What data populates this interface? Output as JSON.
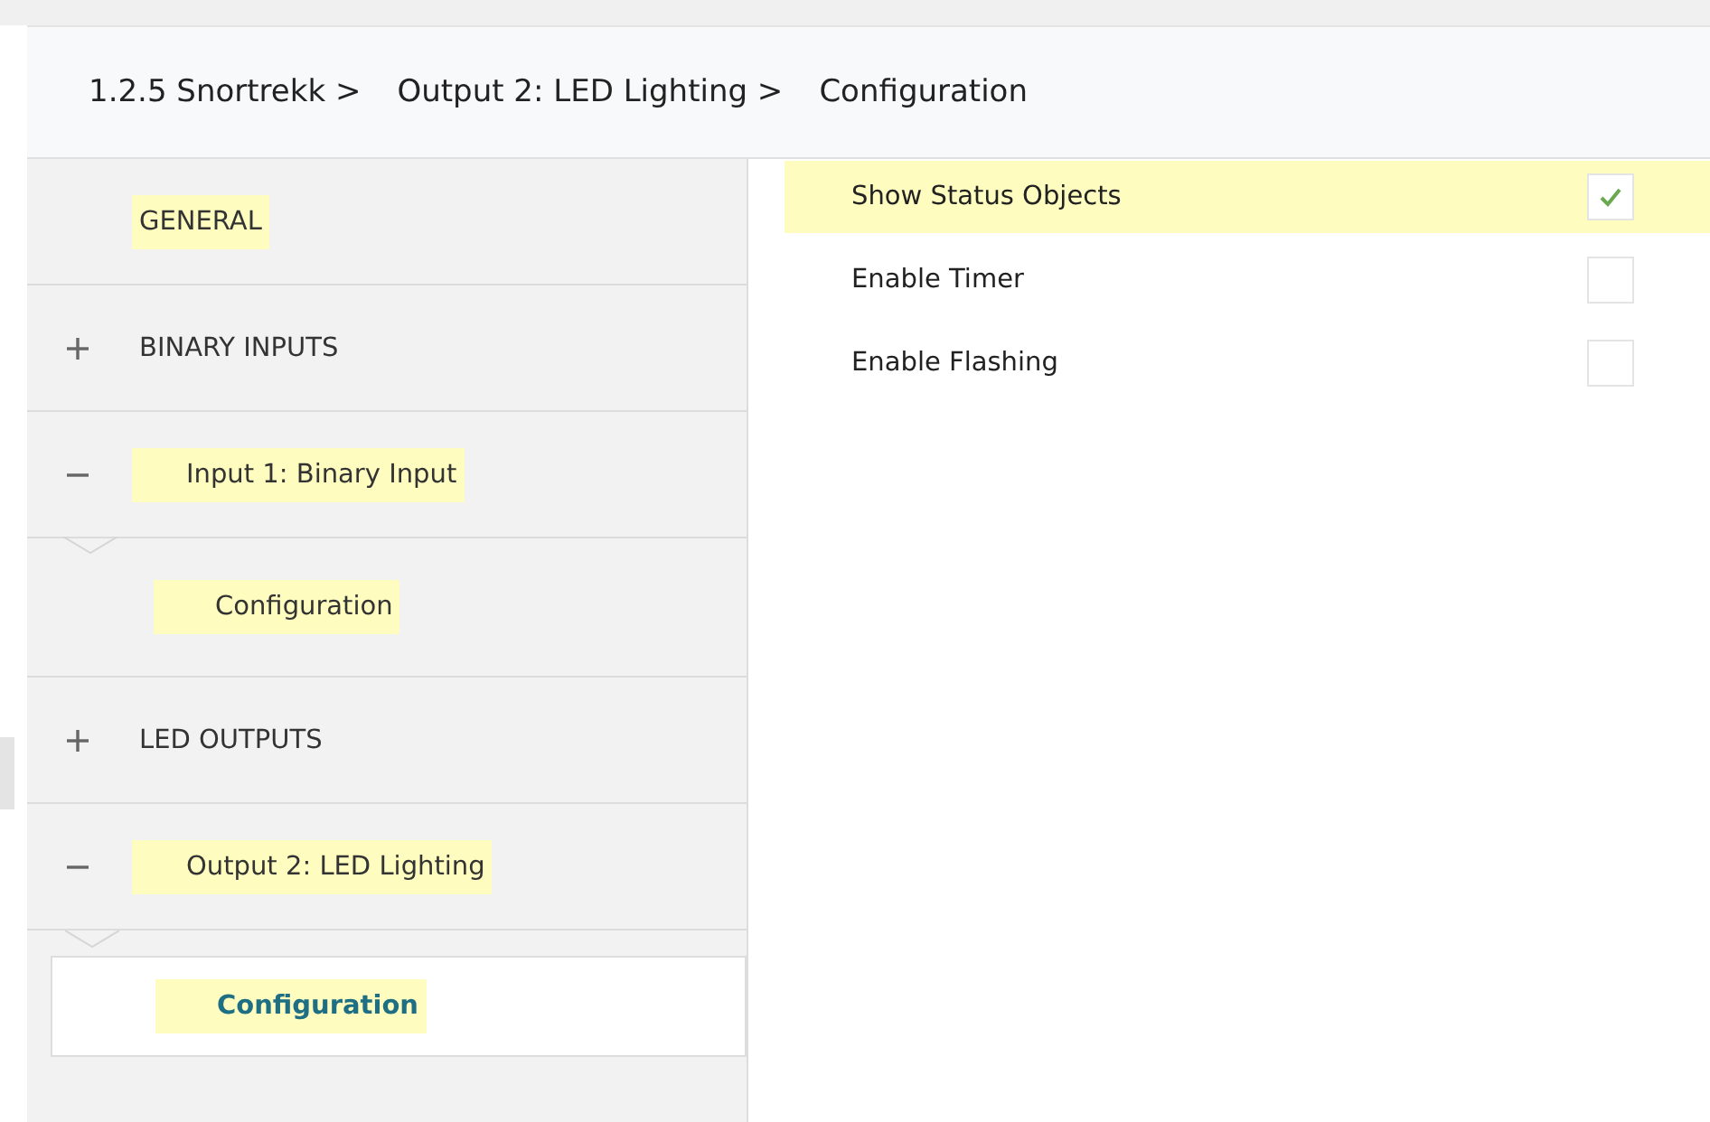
{
  "breadcrumb": [
    {
      "label": "1.2.5 Snortrekk >"
    },
    {
      "label": "Output 2: LED Lighting >"
    },
    {
      "label": "Configuration"
    }
  ],
  "sidebar": {
    "items": [
      {
        "kind": "page",
        "label": "GENERAL",
        "highlighted": true,
        "selected": false
      },
      {
        "kind": "group",
        "label": "BINARY INPUTS",
        "highlighted": false,
        "expanded": false
      },
      {
        "kind": "group",
        "label": "Input 1: Binary Input",
        "highlighted": true,
        "expanded": true,
        "children": [
          {
            "label": "Configuration",
            "highlighted": true,
            "selected": false
          }
        ]
      },
      {
        "kind": "group",
        "label": "LED OUTPUTS",
        "highlighted": false,
        "expanded": false
      },
      {
        "kind": "group",
        "label": "Output 2: LED Lighting",
        "highlighted": true,
        "expanded": true,
        "children": [
          {
            "label": "Configuration",
            "highlighted": true,
            "selected": true
          }
        ]
      }
    ]
  },
  "parameters": [
    {
      "label": "Show Status Objects",
      "checked": true,
      "highlighted": true
    },
    {
      "label": "Enable Timer",
      "checked": false,
      "highlighted": false
    },
    {
      "label": "Enable Flashing",
      "checked": false,
      "highlighted": false
    }
  ]
}
